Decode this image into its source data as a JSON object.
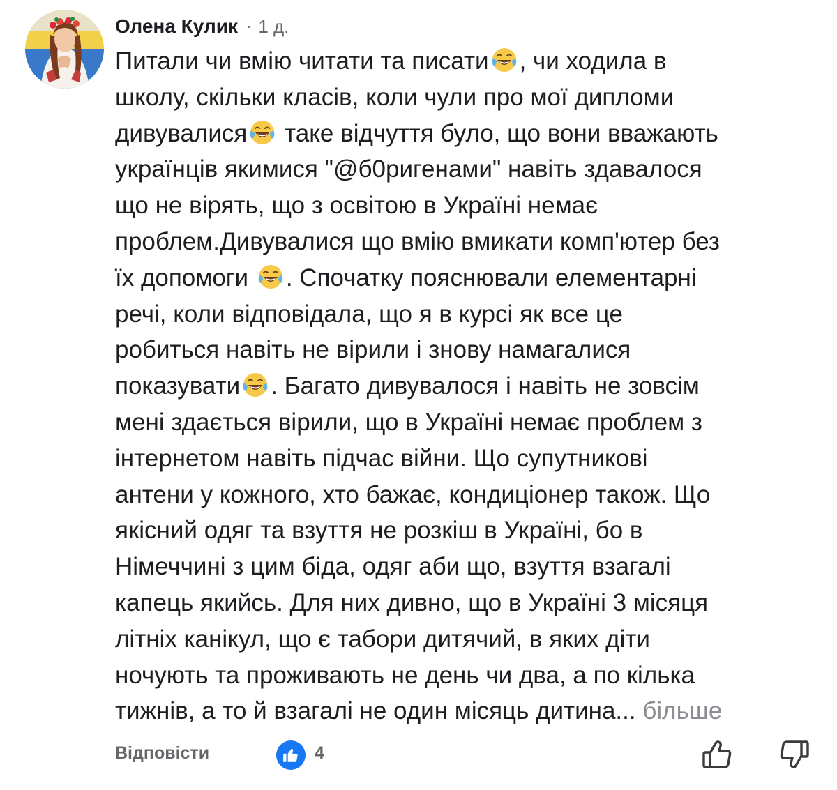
{
  "comment": {
    "author": "Олена Кулик",
    "separator": "·",
    "time": "1 д.",
    "lines": [
      {
        "pre": "Питали чи вмію читати та писати",
        "emoji": true,
        "post": ", чи ходила в"
      },
      {
        "pre": "школу, скільки класів, коли чули про мої дипломи"
      },
      {
        "pre": "дивувалися",
        "emoji": true,
        "post": " таке відчуття було, що вони вважають"
      },
      {
        "pre": "українців якимися \"@б0ригенами\" навіть здавалося"
      },
      {
        "pre": "що не вірять, що з освітою в Україні немає"
      },
      {
        "pre": "проблем.Дивувалися що вмію вмикати комп'ютер без"
      },
      {
        "pre": "їх допомоги ",
        "emoji": true,
        "post": ". Спочатку пояснювали елементарні"
      },
      {
        "pre": "речі, коли відповідала, що я в курсі як все це"
      },
      {
        "pre": "робиться навіть не вірили і знову намагалися"
      },
      {
        "pre": "показувати",
        "emoji": true,
        "post": ". Багато дивувалося і навіть не зовсім"
      },
      {
        "pre": "мені здається вірили, що в Україні немає проблем з"
      },
      {
        "pre": "інтернетом навіть підчас війни. Що супутникові"
      },
      {
        "pre": "антени у кожного, хто бажає, кондиціонер також. Що"
      },
      {
        "pre": "якісний одяг та взуття не розкіш в Україні, бо в"
      },
      {
        "pre": "Німеччині з цим біда, одяг аби що, взуття взагалі"
      },
      {
        "pre": "капець якийсь. Для них дивно, що в Україні 3 місяця"
      },
      {
        "pre": "літніх канікул, що є табори дитячий, в яких діти"
      },
      {
        "pre": "ночують та проживають не день чи два, а по кілька"
      },
      {
        "pre": "тижнів, а то й взагалі не один місяць дитина...",
        "more": " більше"
      }
    ],
    "emoji_icon": "face-with-tears-of-joy-icon"
  },
  "actions": {
    "reply_label": "Відповісти",
    "like_count": "4",
    "like_icon": "like-thumb-icon",
    "react_like_icon": "thumb-up-icon",
    "react_dislike_icon": "thumb-down-icon"
  },
  "colors": {
    "text": "#1c1e21",
    "secondary": "#65676b",
    "more": "#8a8d91",
    "like_blue": "#1877f2"
  }
}
